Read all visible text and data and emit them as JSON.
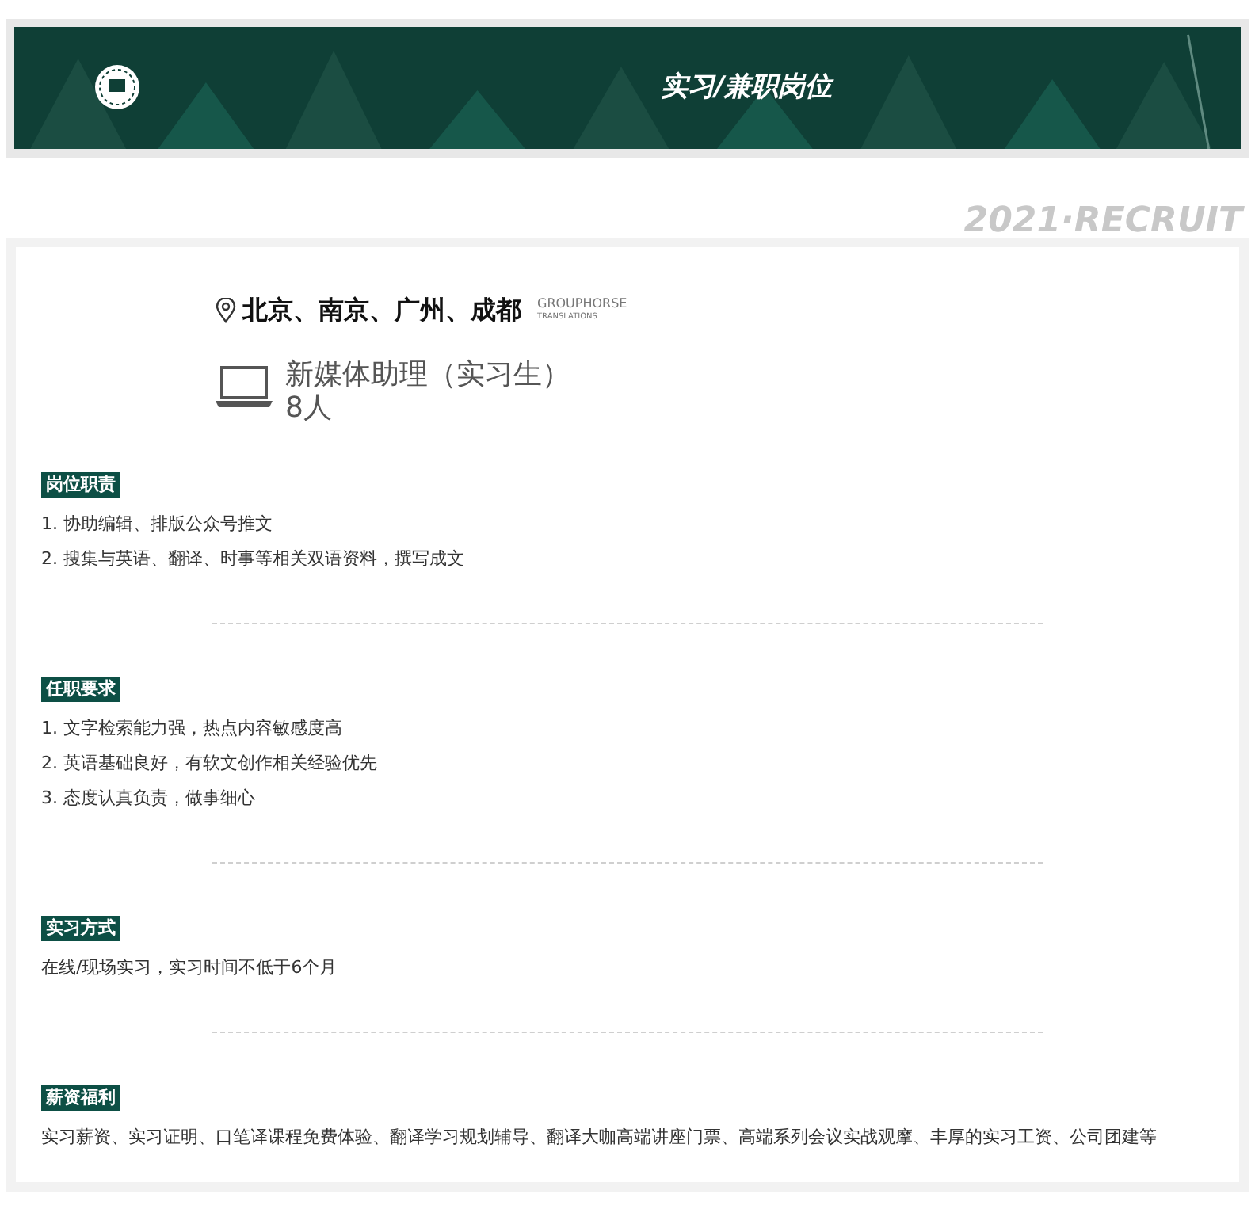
{
  "banner": {
    "title": "实习/兼职岗位"
  },
  "watermark": "2021·RECRUIT",
  "location": "北京、南京、广州、成都",
  "company": [
    "GROUPHORSE",
    "TRANSLATIONS"
  ],
  "position": {
    "title": "新媒体助理（实习生）",
    "count": "8人"
  },
  "sections": [
    {
      "label": "岗位职责",
      "lines": [
        "1. 协助编辑、排版公众号推文",
        "2. 搜集与英语、翻译、时事等相关双语资料，撰写成文"
      ]
    },
    {
      "label": "任职要求",
      "lines": [
        "1. 文字检索能力强，热点内容敏感度高",
        "2. 英语基础良好，有软文创作相关经验优先",
        "3. 态度认真负责，做事细心"
      ]
    },
    {
      "label": "实习方式",
      "lines": [
        "在线/现场实习，实习时间不低于6个月"
      ]
    },
    {
      "label": "薪资福利",
      "lines": [
        "实习薪资、实习证明、口笔译课程免费体验、翻译学习规划辅导、翻译大咖高端讲座门票、高端系列会议实战观摩、丰厚的实习工资、公司团建等"
      ]
    }
  ]
}
